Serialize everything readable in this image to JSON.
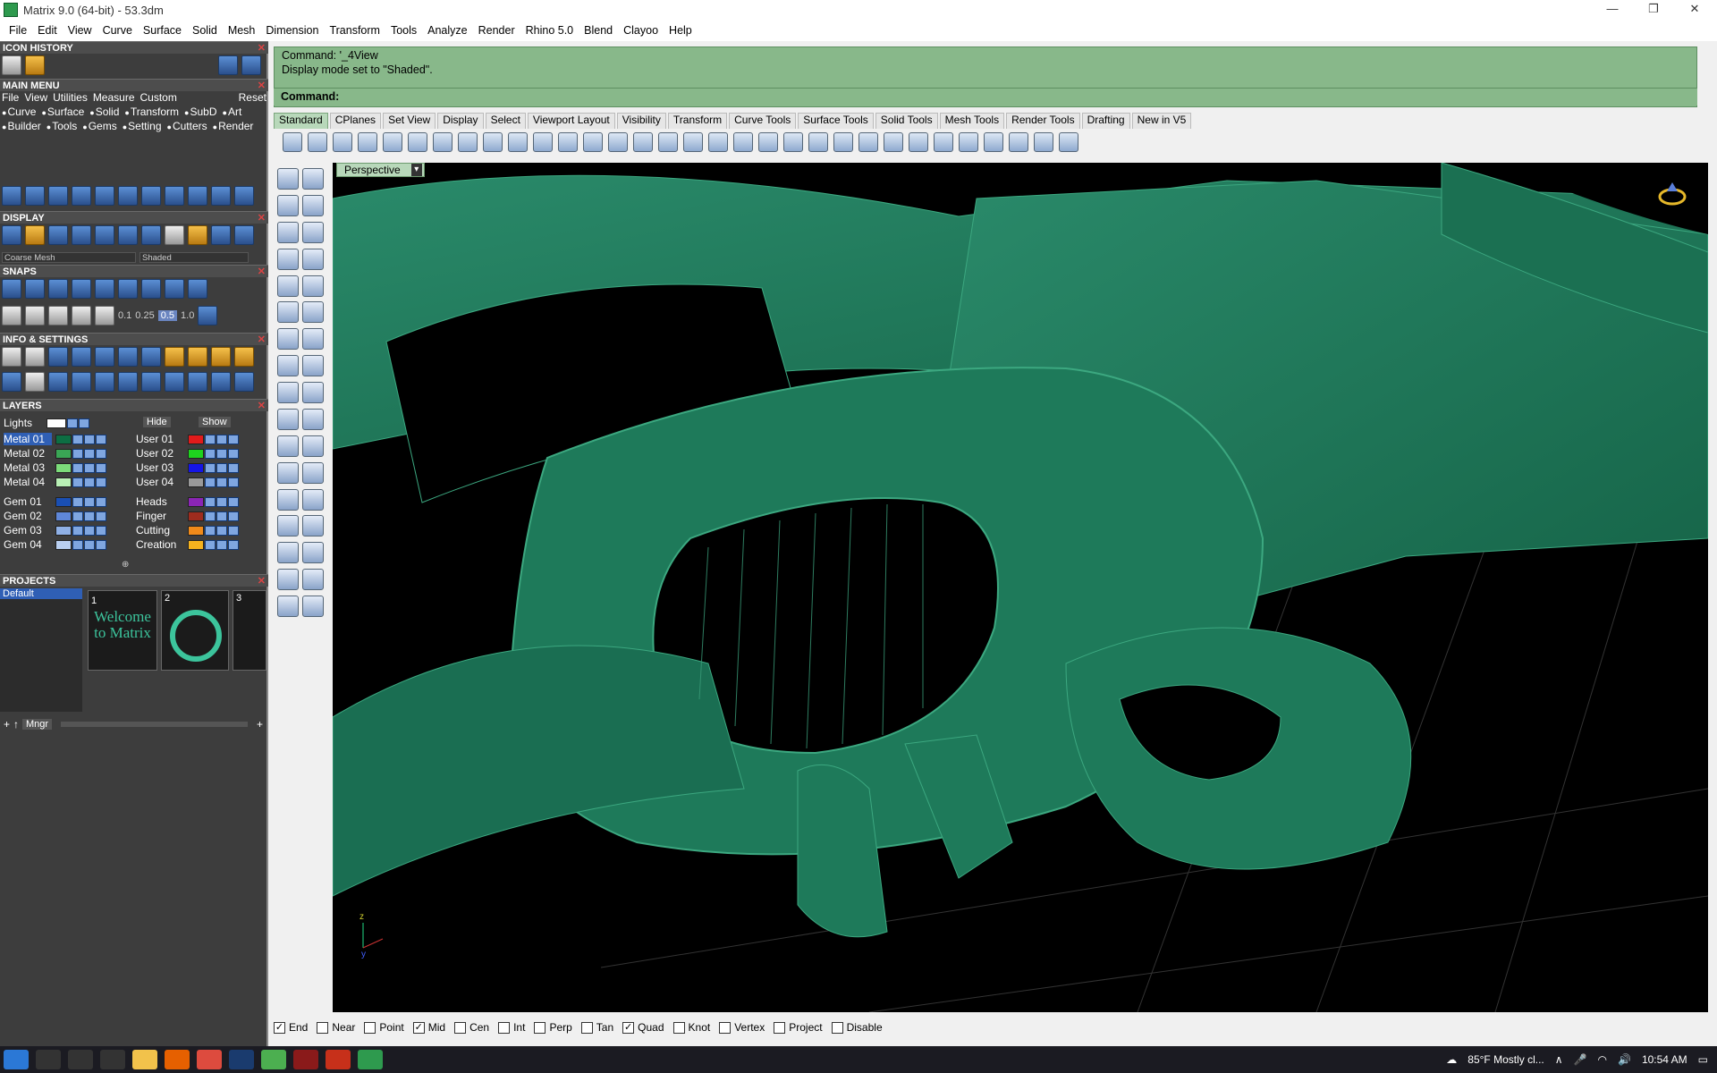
{
  "window": {
    "title": "Matrix 9.0 (64-bit) - 53.3dm"
  },
  "menubar": [
    "File",
    "Edit",
    "View",
    "Curve",
    "Surface",
    "Solid",
    "Mesh",
    "Dimension",
    "Transform",
    "Tools",
    "Analyze",
    "Render",
    "Rhino 5.0",
    "Blend",
    "Clayoo",
    "Help"
  ],
  "left_panel": {
    "icon_history": "ICON HISTORY",
    "main_menu": {
      "title": "MAIN MENU",
      "items": [
        "File",
        "View",
        "Utilities",
        "Measure",
        "Custom"
      ],
      "reset": "Reset",
      "row2": [
        "Curve",
        "Surface",
        "Solid",
        "Transform",
        "SubD",
        "Art"
      ],
      "row3": [
        "Builder",
        "Tools",
        "Gems",
        "Setting",
        "Cutters",
        "Render"
      ]
    },
    "display": {
      "title": "DISPLAY",
      "mesh_select": "Coarse Mesh",
      "mode_select": "Shaded"
    },
    "snaps": {
      "title": "SNAPS",
      "values": [
        "0.1",
        "0.25",
        "0.5",
        "1.0"
      ]
    },
    "info": {
      "title": "INFO & SETTINGS"
    },
    "layers": {
      "title": "LAYERS",
      "lights": "Lights",
      "hide": "Hide",
      "show": "Show",
      "left_layers": [
        {
          "name": "Metal 01",
          "color": "#0d6e43"
        },
        {
          "name": "Metal 02",
          "color": "#3aa655"
        },
        {
          "name": "Metal 03",
          "color": "#7cdc7a"
        },
        {
          "name": "Metal 04",
          "color": "#b9f0b5"
        },
        {
          "name": "Gem 01",
          "color": "#1a4fb3"
        },
        {
          "name": "Gem 02",
          "color": "#5f87d8"
        },
        {
          "name": "Gem 03",
          "color": "#8fb0e6"
        },
        {
          "name": "Gem 04",
          "color": "#b9cff0"
        }
      ],
      "right_layers": [
        {
          "name": "User 01",
          "color": "#e11b1b"
        },
        {
          "name": "User 02",
          "color": "#1ed31e"
        },
        {
          "name": "User 03",
          "color": "#1515e6"
        },
        {
          "name": "User 04",
          "color": "#9a9a9a"
        },
        {
          "name": "Heads",
          "color": "#8b25b5"
        },
        {
          "name": "Finger",
          "color": "#9e2c1e"
        },
        {
          "name": "Cutting",
          "color": "#f08a1a"
        },
        {
          "name": "Creation",
          "color": "#f5b21e"
        }
      ]
    },
    "projects": {
      "title": "PROJECTS",
      "default": "Default",
      "thumbs": [
        {
          "num": "1",
          "text": "Welcome to Matrix"
        },
        {
          "num": "2",
          "text": ""
        },
        {
          "num": "3",
          "text": ""
        }
      ],
      "mngr": "Mngr"
    }
  },
  "command": {
    "line1": "Command: '_4View",
    "line2": "Display mode set to \"Shaded\".",
    "prompt": "Command:"
  },
  "toolbar_tabs": [
    "Standard",
    "CPlanes",
    "Set View",
    "Display",
    "Select",
    "Viewport Layout",
    "Visibility",
    "Transform",
    "Curve Tools",
    "Surface Tools",
    "Solid Tools",
    "Mesh Tools",
    "Render Tools",
    "Drafting",
    "New in V5"
  ],
  "viewport": {
    "label": "Perspective",
    "axis_z": "z",
    "axis_y": "y"
  },
  "osnaps": [
    {
      "label": "End",
      "checked": true
    },
    {
      "label": "Near",
      "checked": false
    },
    {
      "label": "Point",
      "checked": false
    },
    {
      "label": "Mid",
      "checked": true
    },
    {
      "label": "Cen",
      "checked": false
    },
    {
      "label": "Int",
      "checked": false
    },
    {
      "label": "Perp",
      "checked": false
    },
    {
      "label": "Tan",
      "checked": false
    },
    {
      "label": "Quad",
      "checked": true
    },
    {
      "label": "Knot",
      "checked": false
    },
    {
      "label": "Vertex",
      "checked": false
    },
    {
      "label": "Project",
      "checked": false
    },
    {
      "label": "Disable",
      "checked": false
    }
  ],
  "taskbar": {
    "weather": "85°F  Mostly cl...",
    "time": "10:54 AM"
  },
  "colors": {
    "model_green": "#1e7a5a",
    "cmd_bg": "#88b88a"
  }
}
